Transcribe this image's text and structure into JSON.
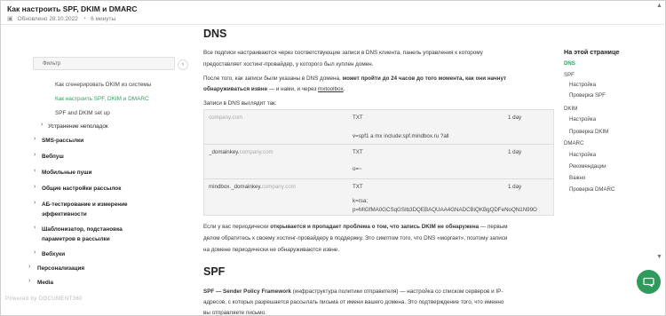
{
  "header": {
    "title": "Как настроить SPF, DKIM и DMARC",
    "updated": "Обновлено 28.10.2022",
    "read_time": "6 минуты"
  },
  "sidebar": {
    "filter_placeholder": "Фильтр",
    "collapse_glyph": "‹",
    "items": [
      {
        "label": "Как сгенерировать DKIM из системы"
      },
      {
        "label": "Как настроить SPF, DKIM и DMARC"
      },
      {
        "label": "SPF and DKIM set up"
      },
      {
        "label": "Устранение неполадок"
      },
      {
        "label": "SMS-рассылки"
      },
      {
        "label": "Вебпуш"
      },
      {
        "label": "Мобильные пуши"
      },
      {
        "label": "Общие настройки рассылок"
      },
      {
        "label": "АБ-тестирование и измерение"
      },
      {
        "label": "эффективности"
      },
      {
        "label": "Шаблонизатор, подстановка"
      },
      {
        "label": "параметров в рассылки"
      },
      {
        "label": "Вебхуки"
      },
      {
        "label": "Персонализация"
      },
      {
        "label": "Media"
      }
    ],
    "powered_by": "Powered by DOCUMENT360"
  },
  "content": {
    "h_dns": "DNS",
    "para1a": "Все подписи настраиваются через соответствующие записи в DNS клиента, панель управления к которому",
    "para1b": "предоставляет хостинг-провайдер, у которого был куплен домен.",
    "para2a_plain": "После того, как записи были указаны в DNS домена, ",
    "para2a_bold": "может пройти до 24 часов до того момента, как они начнут",
    "para2b_bold": "обнаруживаться извне",
    "para2b_plain": " — и нами, и через ",
    "para2b_link": "mxtoolbox",
    "para2b_end": ".",
    "para3": "Записи в DNS выглядит так:",
    "table": {
      "r1_name": "company.com",
      "r1_type": "TXT",
      "r1_ttl": "1 day",
      "r1_value": "v=spf1 a mx include:spf.mindbox.ru ?all",
      "r2_name_dark": "_domainkey.",
      "r2_name_muted": "company.com",
      "r2_type": "TXT",
      "r2_ttl": "1 day",
      "r2_value": "o=~",
      "r3_name_dark": "mindbox._domainkey.",
      "r3_name_muted": "company.com",
      "r3_type": "TXT",
      "r3_ttl": "1 day",
      "r3_value1": "k=rsa;",
      "r3_value2": "p=MIGfMA0GCSqGSIb3DQEBAQUAA4GNADCBiQKBgQDFeNoQN1N99O"
    },
    "para4a_plain": "Если у вас периодически ",
    "para4a_bold": "открывается и пропадает проблема о том, что запись DKIM не обнаружена",
    "para4a_end": " — первым",
    "para4b": "делом обратитесь к своему хостинг-провайдеру в поддержку. Это симптом того, что DNS «моргает», поэтому записи",
    "para4c": "на домене периодически не обнаруживаются извне.",
    "h_spf": "SPF",
    "para5a_bold": "SPF — Sender Policy Framework",
    "para5a_plain": " (инфраструктура политики отправителя) — настройка со списком серверов и IP-",
    "para5b": "адресов, с которых разрешается рассылать письма от имени вашего домена. Это подтверждение того, что именно",
    "para5c": "вы отправляете письмо."
  },
  "toc": {
    "title": "На этой странице",
    "items": [
      {
        "label": "DNS"
      },
      {
        "label": "SPF"
      },
      {
        "label": "Настройка"
      },
      {
        "label": "Проверка SPF"
      },
      {
        "label": "DKIM"
      },
      {
        "label": "Настройка"
      },
      {
        "label": "Проверка DKIM"
      },
      {
        "label": "DMARC"
      },
      {
        "label": "Настройка"
      },
      {
        "label": "Рекомендации"
      },
      {
        "label": "Важно"
      },
      {
        "label": "Проверка DMARC"
      }
    ]
  },
  "colors": {
    "accent": "#2fa05e",
    "chat_button": "#2f9a5c"
  },
  "icons": {
    "calendar": "calendar-icon",
    "clock": "clock-icon",
    "chat": "chat-icon"
  }
}
